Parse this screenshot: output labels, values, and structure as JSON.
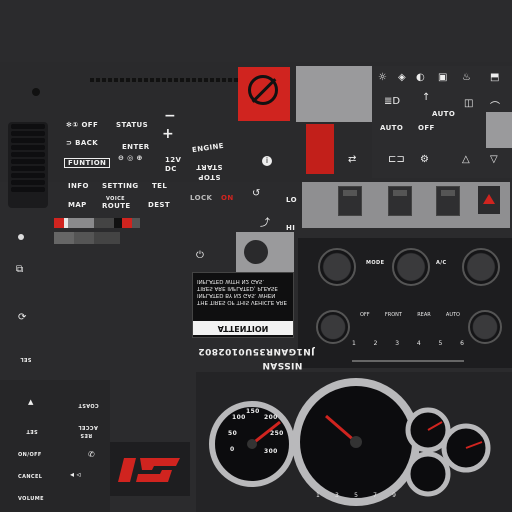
{
  "left": {
    "oil": "OFF",
    "status": "STATUS",
    "back": "BACK",
    "enter": "ENTER",
    "function": "FUNTION",
    "info": "INFO",
    "setting": "SETTING",
    "tel": "TEL",
    "map": "MAP",
    "voice": "VOICE",
    "route": "ROUTE",
    "dest": "DEST",
    "v12": "12V",
    "dc": "DC"
  },
  "center": {
    "engine": "ENGINE",
    "start": "START",
    "stop": "STOP",
    "lock": "LOCK",
    "on": "ON",
    "lo": "LO",
    "hi": "HI"
  },
  "right_controls": {
    "auto": "AUTO",
    "off": "OFF",
    "auto2": "AUTO"
  },
  "climate": {
    "mode": "MODE",
    "ac": "A/C",
    "labels": [
      "OFF",
      "FRONT",
      "REAR",
      "AUTO"
    ],
    "nums": [
      "1",
      "2",
      "3",
      "4",
      "5",
      "6"
    ]
  },
  "sticker": {
    "title": "ATTENTION",
    "body": "THE TIRES OF THIS VEHICLE ARE INFLATED BY N2 GAS. WHEN TIRES ARE INFLATED, PLEASE INFLATED WITH N2 GAS."
  },
  "vin": {
    "make": "NISSAN",
    "code": "JN1GANR35U0102802"
  },
  "gauges": {
    "speed_ticks": [
      "0",
      "50",
      "100",
      "150",
      "200",
      "250",
      "300"
    ],
    "tach_ticks": [
      "1",
      "2",
      "3",
      "4",
      "5",
      "6",
      "7",
      "8",
      "9"
    ]
  },
  "bottom_left": {
    "cancel": "CANCEL",
    "on_off": "ON/OFF",
    "set": "SET",
    "res": "RES",
    "accel": "ACCEL",
    "coast": "COAST",
    "volume": "VOLUME"
  },
  "colors": {
    "accent_red": "#d0241f",
    "panel": "#2b2b2d",
    "gray": "#8f8f91"
  }
}
